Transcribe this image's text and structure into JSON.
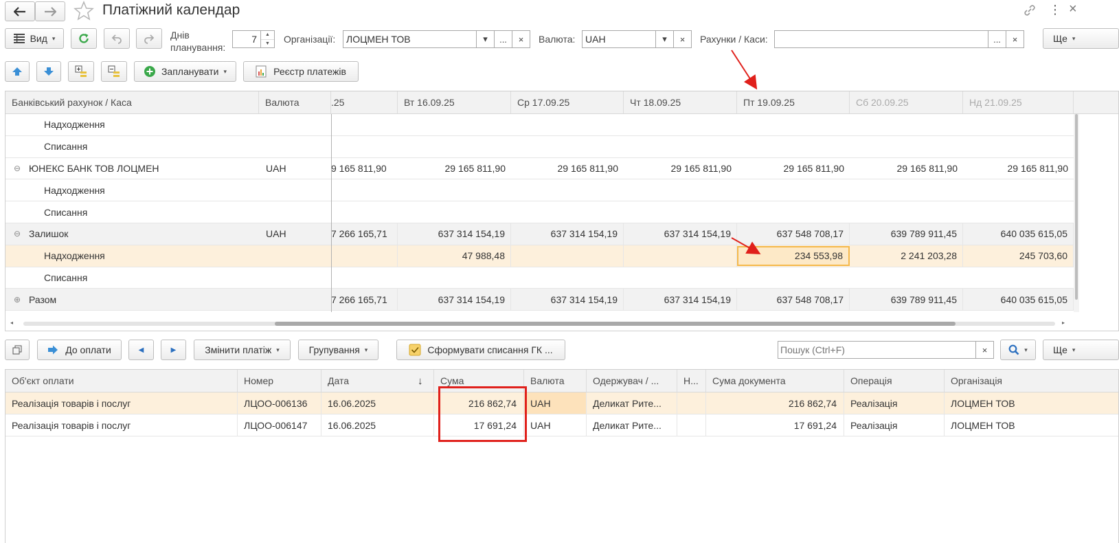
{
  "title": "Платіжний календар",
  "toolbar1": {
    "view_label": "Вид",
    "days_label_1": "Днів",
    "days_label_2": "планування:",
    "days_value": "7",
    "org_label": "Організації:",
    "org_value": "ЛОЦМЕН ТОВ",
    "currency_label": "Валюта:",
    "currency_value": "UAH",
    "accounts_label": "Рахунки / Каси:",
    "accounts_value": "",
    "more_label": "Ще",
    "ellipsis": "...",
    "clear": "×",
    "caret": "▾"
  },
  "toolbar2": {
    "plan_label": "Запланувати",
    "registry_label": "Реєстр платежів"
  },
  "calendar": {
    "headers": [
      "Банківський рахунок / Каса",
      "Валюта",
      ".25",
      "Вт 16.09.25",
      "Ср 17.09.25",
      "Чт 18.09.25",
      "Пт 19.09.25",
      "Сб 20.09.25",
      "Нд 21.09.25"
    ],
    "rows": [
      {
        "name": "Надходження",
        "currency": "",
        "values": [
          "",
          "",
          "",
          "",
          "",
          "",
          ""
        ]
      },
      {
        "name": "Списання",
        "currency": "",
        "values": [
          "",
          "",
          "",
          "",
          "",
          "",
          ""
        ]
      },
      {
        "name": "ЮНЕКС БАНК ТОВ ЛОЦМЕН",
        "currency": "UAH",
        "values": [
          "9 165 811,90",
          "29 165 811,90",
          "29 165 811,90",
          "29 165 811,90",
          "29 165 811,90",
          "29 165 811,90",
          "29 165 811,90"
        ]
      },
      {
        "name": "Надходження",
        "currency": "",
        "values": [
          "",
          "",
          "",
          "",
          "",
          "",
          ""
        ]
      },
      {
        "name": "Списання",
        "currency": "",
        "values": [
          "",
          "",
          "",
          "",
          "",
          "",
          ""
        ]
      },
      {
        "name": "Залишок",
        "currency": "UAH",
        "values": [
          "7 266 165,71",
          "637 314 154,19",
          "637 314 154,19",
          "637 314 154,19",
          "637 548 708,17",
          "639 789 911,45",
          "640 035 615,05"
        ]
      },
      {
        "name": "Надходження",
        "currency": "",
        "values": [
          "",
          "47 988,48",
          "",
          "",
          "234 553,98",
          "2 241 203,28",
          "245 703,60"
        ]
      },
      {
        "name": "Списання",
        "currency": "",
        "values": [
          "",
          "",
          "",
          "",
          "",
          "",
          ""
        ]
      },
      {
        "name": "Разом",
        "currency": "",
        "values": [
          "7 266 165,71",
          "637 314 154,19",
          "637 314 154,19",
          "637 314 154,19",
          "637 548 708,17",
          "639 789 911,45",
          "640 035 615,05"
        ]
      }
    ]
  },
  "toolbar3": {
    "to_pay_label": "До оплати",
    "change_label": "Змінити платіж",
    "group_label": "Групування",
    "form_label": "Сформувати списання ГК ...",
    "search_placeholder": "Пошук (Ctrl+F)",
    "more_label": "Ще"
  },
  "payments": {
    "headers": [
      "Об'єкт оплати",
      "Номер",
      "Дата",
      "Сума",
      "Валюта",
      "Одержувач / ...",
      "Н...",
      "Сума документа",
      "Операція",
      "Організація"
    ],
    "rows": [
      {
        "object": "Реалізація товарів і послуг",
        "number": "ЛЦОО-006136",
        "date": "16.06.2025",
        "sum": "216 862,74",
        "currency": "UAH",
        "recipient": "Деликат Рите...",
        "n": "",
        "doc_sum": "216 862,74",
        "operation": "Реалізація",
        "org": "ЛОЦМЕН ТОВ"
      },
      {
        "object": "Реалізація товарів і послуг",
        "number": "ЛЦОО-006147",
        "date": "16.06.2025",
        "sum": "17 691,24",
        "currency": "UAH",
        "recipient": "Деликат Рите...",
        "n": "",
        "doc_sum": "17 691,24",
        "operation": "Реалізація",
        "org": "ЛОЦМЕН ТОВ"
      }
    ]
  },
  "colors": {
    "highlight_row": "#fdf0dc",
    "selected_cell_border": "#f5b84a",
    "annotation_red": "#e0201b",
    "green_icon": "#3aa84a",
    "blue_arrow": "#3a8fd6"
  },
  "icons": [
    "back-arrow-icon",
    "forward-arrow-icon",
    "star-icon",
    "link-icon",
    "more-vert-icon",
    "grid-icon",
    "refresh-icon",
    "undo-icon",
    "redo-icon",
    "move-up-icon",
    "move-down-icon",
    "expand-icon",
    "collapse-icon",
    "plus-circle-icon",
    "report-icon",
    "window-icon",
    "arrow-right-icon",
    "prev-icon",
    "next-icon",
    "checkbox-icon",
    "search-icon"
  ]
}
